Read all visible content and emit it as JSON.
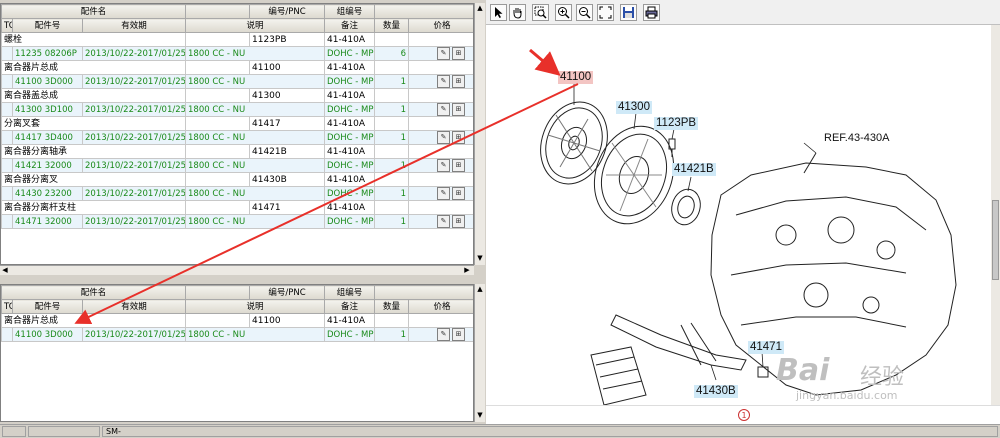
{
  "top_grid": {
    "header1": [
      "",
      "配件名",
      "编号/PNC",
      "组编号",
      "",
      ""
    ],
    "header2": [
      "TC",
      "配件号",
      "有效期",
      "说明",
      "备注",
      "数量",
      "价格"
    ],
    "groups": [
      {
        "name": "螺栓",
        "pnc": "1123PB",
        "group": "41-410A",
        "part": "11235 08206P",
        "date": "2013/10/22-2017/01/25",
        "desc": "1800 CC - NU",
        "remark": "DOHC - MPI >MAN",
        "qty": "6"
      },
      {
        "name": "离合器片总成",
        "pnc": "41100",
        "group": "41-410A",
        "part": "41100 3D000",
        "date": "2013/10/22-2017/01/25",
        "desc": "1800 CC - NU",
        "remark": "DOHC - MPI >MAN",
        "qty": "1"
      },
      {
        "name": "离合器盖总成",
        "pnc": "41300",
        "group": "41-410A",
        "part": "41300 3D100",
        "date": "2013/10/22-2017/01/25",
        "desc": "1800 CC - NU",
        "remark": "DOHC - MPI >MAN",
        "qty": "1"
      },
      {
        "name": "分离叉套",
        "pnc": "41417",
        "group": "41-410A",
        "part": "41417 3D400",
        "date": "2013/10/22-2017/01/25",
        "desc": "1800 CC - NU",
        "remark": "DOHC - MPI >MAN",
        "qty": "1"
      },
      {
        "name": "离合器分离轴承",
        "pnc": "41421B",
        "group": "41-410A",
        "part": "41421 32000",
        "date": "2013/10/22-2017/01/25",
        "desc": "1800 CC - NU",
        "remark": "DOHC - MPI >MAN",
        "qty": "1"
      },
      {
        "name": "离合器分离叉",
        "pnc": "41430B",
        "group": "41-410A",
        "part": "41430 23200",
        "date": "2013/10/22-2017/01/25",
        "desc": "1800 CC - NU",
        "remark": "DOHC - MPI >MAN",
        "qty": "1"
      },
      {
        "name": "离合器分离杆支柱",
        "pnc": "41471",
        "group": "41-410A",
        "part": "41471 32000",
        "date": "2013/10/22-2017/01/25",
        "desc": "1800 CC - NU",
        "remark": "DOHC - MPI >MAN",
        "qty": "1"
      }
    ]
  },
  "bottom_grid": {
    "header1": [
      "",
      "配件名",
      "编号/PNC",
      "组编号",
      "",
      ""
    ],
    "header2": [
      "TC",
      "配件号",
      "有效期",
      "说明",
      "备注",
      "数量",
      "价格"
    ],
    "groups": [
      {
        "name": "离合器片总成",
        "pnc": "41100",
        "group": "41-410A",
        "part": "41100 3D000",
        "date": "2013/10/22-2017/01/25",
        "desc": "1800 CC - NU",
        "remark": "DOHC - MPI >MAN",
        "qty": "1"
      }
    ]
  },
  "status_bar": {
    "cell3": "SM-"
  },
  "diagram": {
    "labels": {
      "p41100": "41100",
      "p41300": "41300",
      "p1123PB": "1123PB",
      "p41421B": "41421B",
      "pref": "REF.43-430A",
      "p41471": "41471",
      "p41430B": "41430B"
    },
    "page": "1"
  },
  "watermark": {
    "brand": "Bai",
    "brand2": "经验",
    "url": "jingyan.baidu.com"
  },
  "colors": {
    "arrow": "#e8302a",
    "highlight": "#cfe9f7",
    "selected": "#f3c5c3",
    "detail_text": "#1a8a1a"
  }
}
